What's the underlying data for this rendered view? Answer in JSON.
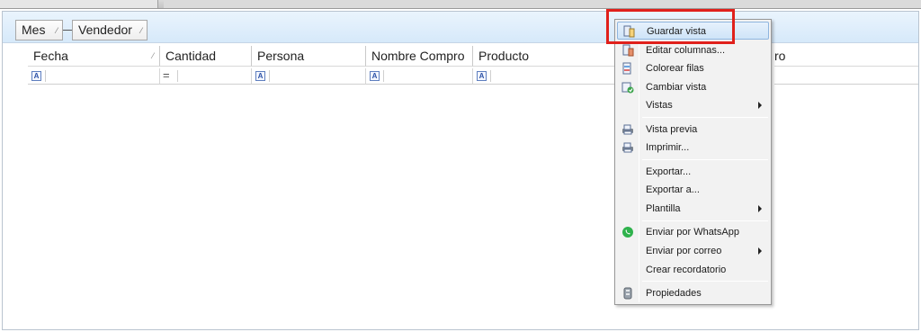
{
  "group_panel": {
    "groups": [
      {
        "label": "Mes"
      },
      {
        "label": "Vendedor"
      }
    ]
  },
  "columns": [
    {
      "label": "Fecha",
      "filter": "A"
    },
    {
      "label": "Cantidad",
      "filter": "="
    },
    {
      "label": "Persona",
      "filter": "A"
    },
    {
      "label": "Nombre Compro",
      "filter": "A"
    },
    {
      "label": "Producto",
      "filter": "A"
    },
    {
      "label": "ro"
    }
  ],
  "context_menu": {
    "items": [
      {
        "label": "Guardar vista",
        "icon": "save-view-icon",
        "highlighted": true
      },
      {
        "label": "Editar columnas...",
        "icon": "edit-columns-icon"
      },
      {
        "label": "Colorear filas",
        "icon": "color-rows-icon"
      },
      {
        "label": "Cambiar vista",
        "icon": "change-view-icon"
      },
      {
        "label": "Vistas",
        "submenu": true
      },
      {
        "label": "Vista previa",
        "icon": "print-preview-icon"
      },
      {
        "label": "Imprimir...",
        "icon": "printer-icon"
      },
      {
        "label": "Exportar..."
      },
      {
        "label": "Exportar a..."
      },
      {
        "label": "Plantilla",
        "submenu": true
      },
      {
        "label": "Enviar por WhatsApp",
        "icon": "whatsapp-icon"
      },
      {
        "label": "Enviar por correo",
        "submenu": true
      },
      {
        "label": "Crear recordatorio"
      },
      {
        "label": "Propiedades",
        "icon": "properties-icon"
      }
    ]
  },
  "colors": {
    "highlight_border": "#e0201b",
    "menu_background": "#f2f2f2",
    "group_panel": "#d6e9fa"
  }
}
